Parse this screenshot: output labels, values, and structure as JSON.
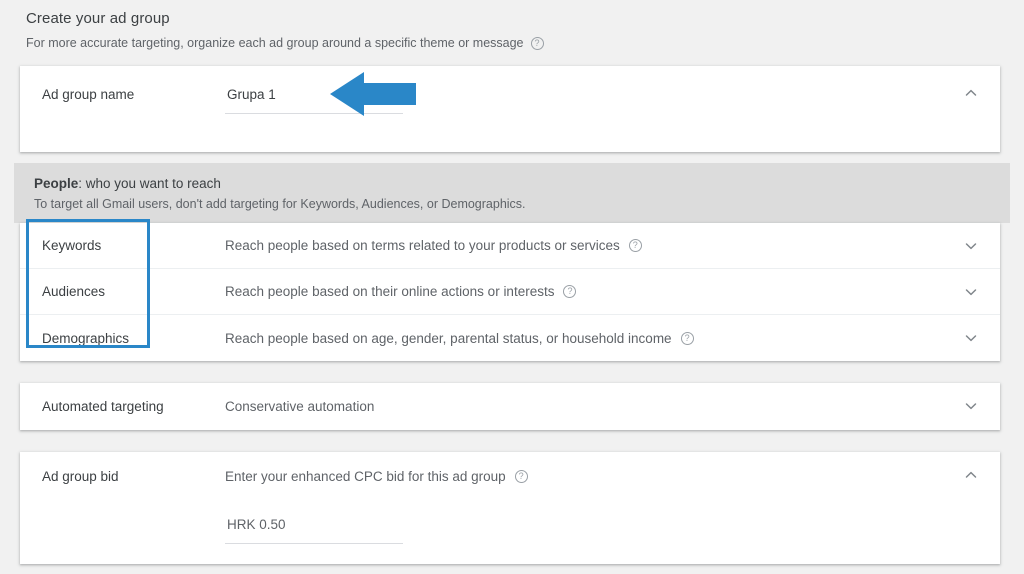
{
  "page": {
    "title": "Create your ad group",
    "subtitle": "For more accurate targeting, organize each ad group around a specific theme or message",
    "help_icon": "?"
  },
  "ad_group_name": {
    "label": "Ad group name",
    "value": "Grupa 1",
    "placeholder": "Ad group name",
    "chevron": "chevron-up"
  },
  "people": {
    "title_strong": "People",
    "title_rest": ": who you want to reach",
    "subtitle": "To target all Gmail users, don't add targeting for Keywords, Audiences, or Demographics.",
    "rows": [
      {
        "label": "Keywords",
        "description": "Reach people based on terms related to your products or services",
        "chevron": "chevron-down"
      },
      {
        "label": "Audiences",
        "description": "Reach people based on their online actions or interests",
        "chevron": "chevron-down"
      },
      {
        "label": "Demographics",
        "description": "Reach people based on age, gender, parental status, or household income",
        "chevron": "chevron-down"
      }
    ]
  },
  "automated_targeting": {
    "label": "Automated targeting",
    "value": "Conservative automation",
    "chevron": "chevron-down"
  },
  "ad_group_bid": {
    "label": "Ad group bid",
    "description": "Enter your enhanced CPC bid for this ad group",
    "bid_value": "HRK 0.50",
    "bid_placeholder": "HRK 0.50",
    "chevron": "chevron-up"
  },
  "annotations": {
    "arrow_color": "#2a87c8",
    "box_color": "#2a87c8",
    "arrow_direction": "left",
    "arrow_points_to": "Grupa 1",
    "box_surrounds": "Keywords, Audiences, Demographics"
  },
  "colors": {
    "page_background": "#f1f1f1",
    "card_background": "#ffffff",
    "band_background": "#dcdcdc",
    "primary_text": "#3c4043",
    "secondary_text": "#5f6368",
    "divider": "#dadce0",
    "accent": "#2a87c8"
  }
}
